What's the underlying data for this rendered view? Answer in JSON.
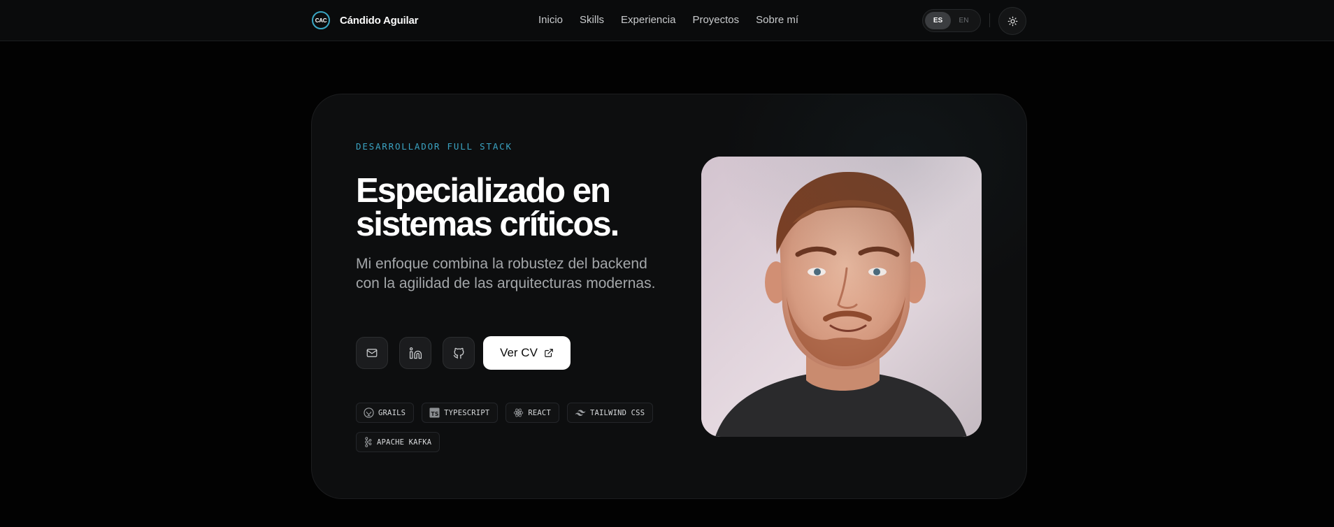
{
  "header": {
    "logo_text": "CAC",
    "brand_name": "Cándido Aguilar",
    "nav": [
      "Inicio",
      "Skills",
      "Experiencia",
      "Proyectos",
      "Sobre mí"
    ],
    "lang_active": "ES",
    "lang_inactive": "EN",
    "theme_icon": "sun-icon"
  },
  "hero": {
    "eyebrow": "DESARROLLADOR FULL STACK",
    "headline": "Especializado en sistemas críticos.",
    "lead": "Mi enfoque combina la robustez del backend con la agilidad de las arquitecturas modernas.",
    "social_icons": [
      "mail-icon",
      "linkedin-icon",
      "github-icon"
    ],
    "cv_label": "Ver CV",
    "cv_icon": "external-link-icon",
    "tags": [
      "GRAILS",
      "TYPESCRIPT",
      "REACT",
      "TAILWIND CSS",
      "APACHE KAFKA"
    ],
    "tag_icons": [
      "grails-icon",
      "typescript-icon",
      "react-icon",
      "tailwind-icon",
      "kafka-icon"
    ]
  },
  "colors": {
    "accent": "#3ba3c2",
    "background": "#020202",
    "card": "#0d0e0f",
    "primary_button": "#ffffff"
  }
}
